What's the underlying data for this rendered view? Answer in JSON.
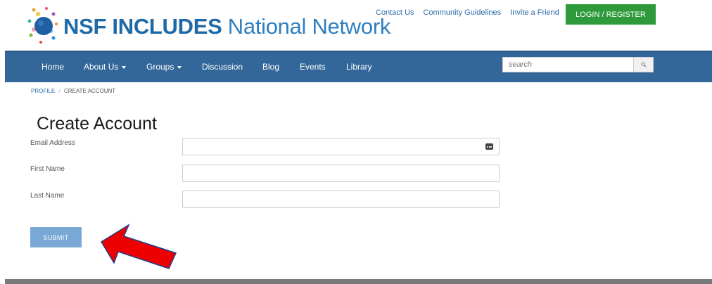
{
  "site": {
    "logo_bold": "NSF INCLUDES",
    "logo_light": "National Network"
  },
  "top_links": [
    "Contact Us",
    "Community Guidelines",
    "Invite a Friend"
  ],
  "login_button": "LOGIN / REGISTER",
  "nav": {
    "home": "Home",
    "about": "About Us",
    "groups": "Groups",
    "discussion": "Discussion",
    "blog": "Blog",
    "events": "Events",
    "library": "Library"
  },
  "search": {
    "placeholder": "search",
    "icon": "search-icon"
  },
  "breadcrumb": {
    "parent": "PROFILE",
    "separator": "/",
    "current": "CREATE ACCOUNT"
  },
  "page_title": "Create Account",
  "form": {
    "email_label": "Email Address",
    "email_value": "",
    "first_name_label": "First Name",
    "first_name_value": "",
    "last_name_label": "Last Name",
    "last_name_value": "",
    "submit_label": "SUBMIT"
  },
  "colors": {
    "nav_bg": "#336799",
    "login_green": "#2f9a3b",
    "submit_blue": "#79a7d6",
    "annotation_arrow": "#ee0000"
  }
}
